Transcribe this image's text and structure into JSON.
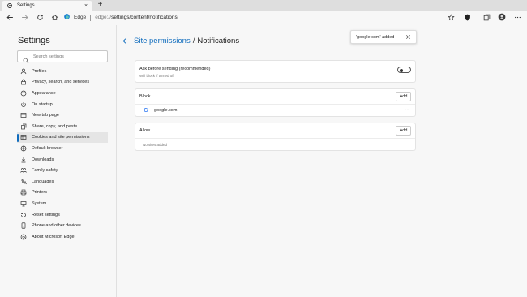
{
  "tab": {
    "title": "Settings",
    "close": "×",
    "new_tab": "+"
  },
  "address": {
    "brand": "Edge",
    "url_host": "edge://",
    "url_path": "settings/content/notifications"
  },
  "sidebar": {
    "title": "Settings",
    "search_placeholder": "Search settings",
    "items": [
      {
        "label": "Profiles",
        "icon": "person-icon"
      },
      {
        "label": "Privacy, search, and services",
        "icon": "lock-icon"
      },
      {
        "label": "Appearance",
        "icon": "palette-icon"
      },
      {
        "label": "On startup",
        "icon": "power-icon"
      },
      {
        "label": "New tab page",
        "icon": "newtab-icon"
      },
      {
        "label": "Share, copy, and paste",
        "icon": "share-icon"
      },
      {
        "label": "Cookies and site permissions",
        "icon": "cookie-icon",
        "active": true
      },
      {
        "label": "Default browser",
        "icon": "browser-icon"
      },
      {
        "label": "Downloads",
        "icon": "download-icon"
      },
      {
        "label": "Family safety",
        "icon": "family-icon"
      },
      {
        "label": "Languages",
        "icon": "language-icon"
      },
      {
        "label": "Printers",
        "icon": "printer-icon"
      },
      {
        "label": "System",
        "icon": "system-icon"
      },
      {
        "label": "Reset settings",
        "icon": "reset-icon"
      },
      {
        "label": "Phone and other devices",
        "icon": "phone-icon"
      },
      {
        "label": "About Microsoft Edge",
        "icon": "edge-icon"
      }
    ]
  },
  "main": {
    "breadcrumb_link": "Site permissions",
    "breadcrumb_sep": "/",
    "breadcrumb_current": "Notifications",
    "toast": "'google.com' added",
    "ask": {
      "title": "Ask before sending (recommended)",
      "subtitle": "Will block if turned off",
      "toggle_on": false
    },
    "block": {
      "header": "Block",
      "add_label": "Add",
      "sites": [
        {
          "name": "google.com",
          "favicon": "G"
        }
      ],
      "more": "···"
    },
    "allow": {
      "header": "Allow",
      "add_label": "Add",
      "empty": "No sites added"
    }
  },
  "colors": {
    "accent": "#0f6cbd",
    "background": "#f7f7f7",
    "card": "#ffffff"
  }
}
